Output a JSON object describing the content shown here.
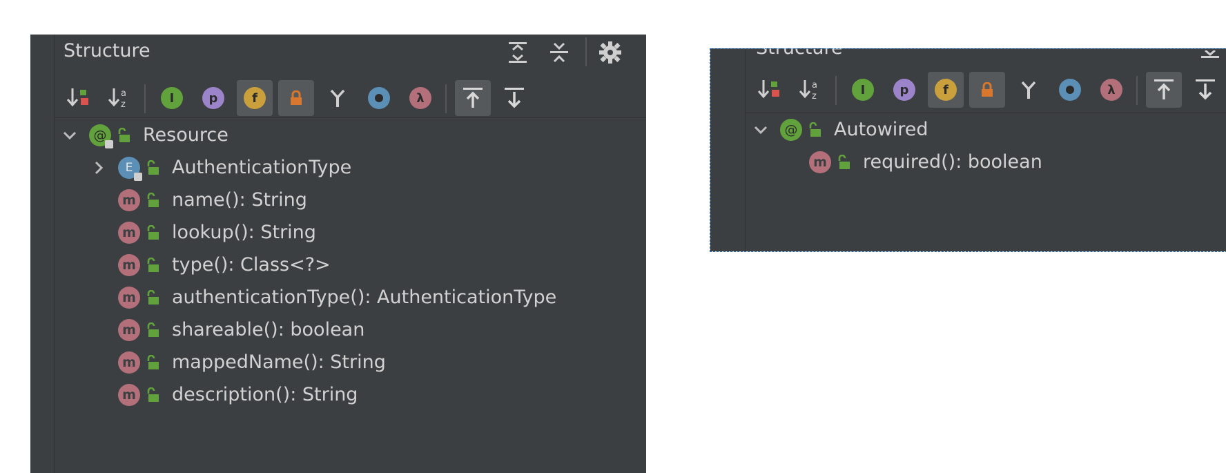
{
  "left_panel": {
    "title": "Structure",
    "tree": {
      "root_label": "Resource",
      "items": [
        {
          "label": "AuthenticationType",
          "kind": "enum",
          "expandable": true
        },
        {
          "label": "name(): String",
          "kind": "method"
        },
        {
          "label": "lookup(): String",
          "kind": "method"
        },
        {
          "label": "type(): Class<?>",
          "kind": "method"
        },
        {
          "label": "authenticationType(): AuthenticationType",
          "kind": "method"
        },
        {
          "label": "shareable(): boolean",
          "kind": "method"
        },
        {
          "label": "mappedName(): String",
          "kind": "method"
        },
        {
          "label": "description(): String",
          "kind": "method"
        }
      ]
    }
  },
  "right_panel": {
    "title": "Structure",
    "tree": {
      "root_label": "Autowired",
      "items": [
        {
          "label": "required(): boolean",
          "kind": "method"
        }
      ]
    }
  },
  "toolbar_icons": {
    "inherited": "I",
    "properties": "p",
    "fields": "f",
    "lambda": "λ",
    "method": "m",
    "annotation": "@",
    "enum": "E"
  },
  "colors": {
    "panel_bg": "#3c3f41",
    "method_badge": "#b3707a",
    "annotation_badge": "#62a23d",
    "enum_badge": "#5b8fb6",
    "fields_badge": "#c9a03b",
    "properties_badge": "#9b84c9",
    "lambda_badge": "#b3707a",
    "visibility_green": "#62a23d",
    "selection_frame": "#2f6fb5"
  }
}
